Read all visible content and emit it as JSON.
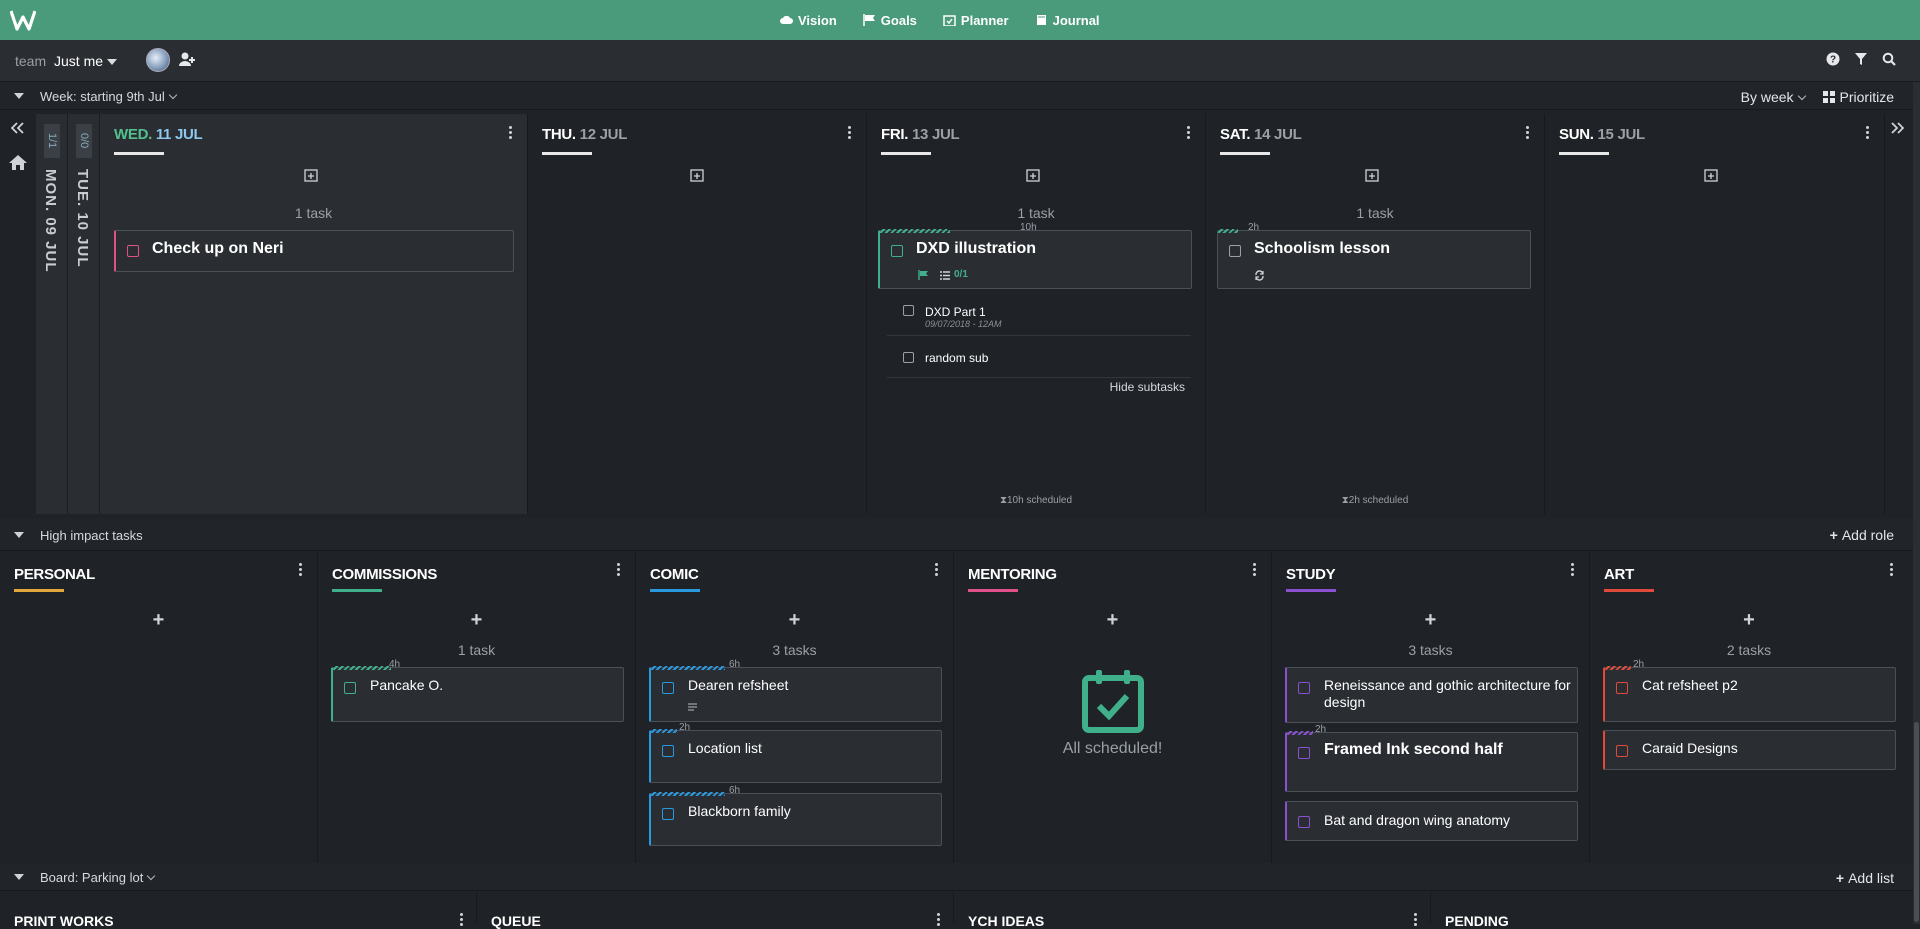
{
  "nav": {
    "vision": "Vision",
    "goals": "Goals",
    "planner": "Planner",
    "journal": "Journal"
  },
  "team": {
    "label": "team",
    "value": "Just me"
  },
  "week": {
    "title": "Week: starting 9th Jul",
    "view": "By week",
    "prioritize": "Prioritize",
    "collapsed": [
      {
        "count": "1/1",
        "label": "MON. 09 JUL"
      },
      {
        "count": "0/0",
        "label": "TUE. 10 JUL"
      }
    ],
    "days": [
      {
        "dow": "WED.",
        "date": "11 JUL",
        "count": "1 task",
        "tasks": [
          {
            "title": "Check up on Neri",
            "color": "#e0508a"
          }
        ]
      },
      {
        "dow": "THU.",
        "date": "12 JUL",
        "count": "",
        "tasks": []
      },
      {
        "dow": "FRI.",
        "date": "13 JUL",
        "count": "1 task",
        "tasks": [
          {
            "title": "DXD illustration",
            "est": "10h",
            "color": "#3fb08a",
            "subcount": "0/1",
            "subtasks": [
              {
                "title": "DXD Part 1",
                "date": "09/07/2018 - 12AM"
              },
              {
                "title": "random sub"
              }
            ],
            "hide": "Hide subtasks"
          }
        ],
        "scheduled": "10h scheduled"
      },
      {
        "dow": "SAT.",
        "date": "14 JUL",
        "count": "1 task",
        "tasks": [
          {
            "title": "Schoolism lesson",
            "est": "2h",
            "color": "#9aa0a6"
          }
        ],
        "scheduled": "2h scheduled"
      },
      {
        "dow": "SUN.",
        "date": "15 JUL",
        "count": "",
        "tasks": []
      }
    ]
  },
  "hi": {
    "title": "High impact tasks",
    "add_role": "Add role",
    "roles": [
      {
        "name": "PERSONAL",
        "color": "#e0a83a",
        "count": "",
        "tasks": []
      },
      {
        "name": "COMMISSIONS",
        "color": "#3fb08a",
        "count": "1 task",
        "tasks": [
          {
            "title": "Pancake O.",
            "est": "4h"
          }
        ]
      },
      {
        "name": "COMIC",
        "color": "#2a9ae0",
        "count": "3 tasks",
        "tasks": [
          {
            "title": "Dearen refsheet",
            "est": "6h"
          },
          {
            "title": "Location list",
            "est": "2h"
          },
          {
            "title": "Blackborn family",
            "est": "6h"
          }
        ]
      },
      {
        "name": "MENTORING",
        "color": "#e0508a",
        "count": "",
        "tasks": [],
        "empty": "All scheduled!"
      },
      {
        "name": "STUDY",
        "color": "#8a50d0",
        "count": "3 tasks",
        "tasks": [
          {
            "title": "Reneissance and gothic architecture for design"
          },
          {
            "title": "Framed Ink second half",
            "est": "2h"
          },
          {
            "title": "Bat and dragon wing anatomy"
          }
        ]
      },
      {
        "name": "ART",
        "color": "#e04a3a",
        "count": "2 tasks",
        "tasks": [
          {
            "title": "Cat refsheet p2",
            "est": "2h"
          },
          {
            "title": "Caraid Designs"
          }
        ]
      }
    ]
  },
  "board": {
    "title": "Board: Parking lot",
    "add_list": "Add list",
    "lists": [
      "PRINT WORKS",
      "QUEUE",
      "YCH IDEAS",
      "PENDING"
    ]
  },
  "colors": {
    "brand": "#4a9b7b"
  }
}
